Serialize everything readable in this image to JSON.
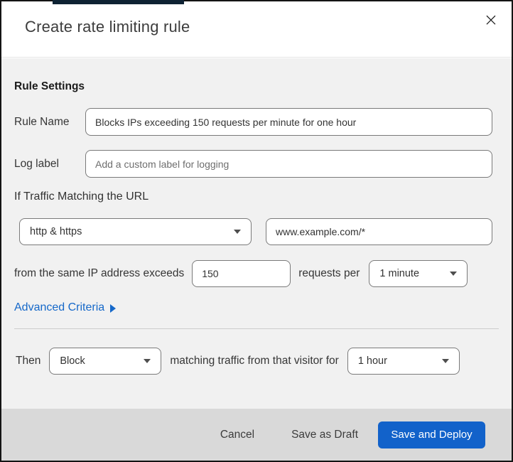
{
  "modal": {
    "title": "Create rate limiting rule"
  },
  "icons": {
    "close": "×",
    "dropdown_caret": "triangle-down",
    "advanced_arrow": "triangle-right"
  },
  "colors": {
    "accent_blue": "#1262ca",
    "link_blue": "#1568c9",
    "top_bar": "#0e2233",
    "body_bg": "#f1f1f1",
    "footer_bg": "#d9d9d9",
    "input_border": "#7a7a7a"
  },
  "form": {
    "section_heading": "Rule Settings",
    "rule_name": {
      "label": "Rule Name",
      "value": "Blocks IPs exceeding 150 requests per minute for one hour"
    },
    "log_label": {
      "label": "Log label",
      "placeholder": "Add a custom label for logging"
    },
    "traffic_match": {
      "heading": "If Traffic Matching the URL",
      "scheme_selected": "http & https",
      "url_value": "www.example.com/*"
    },
    "threshold": {
      "prefix": "from the same IP address exceeds",
      "requests_value": "150",
      "middle": "requests per",
      "period_selected": "1 minute"
    },
    "advanced_link": "Advanced Criteria",
    "action": {
      "prefix": "Then",
      "action_selected": "Block",
      "middle": "matching traffic from that visitor for",
      "duration_selected": "1 hour"
    }
  },
  "footer": {
    "cancel": "Cancel",
    "save_draft": "Save as Draft",
    "save_deploy": "Save and Deploy"
  }
}
